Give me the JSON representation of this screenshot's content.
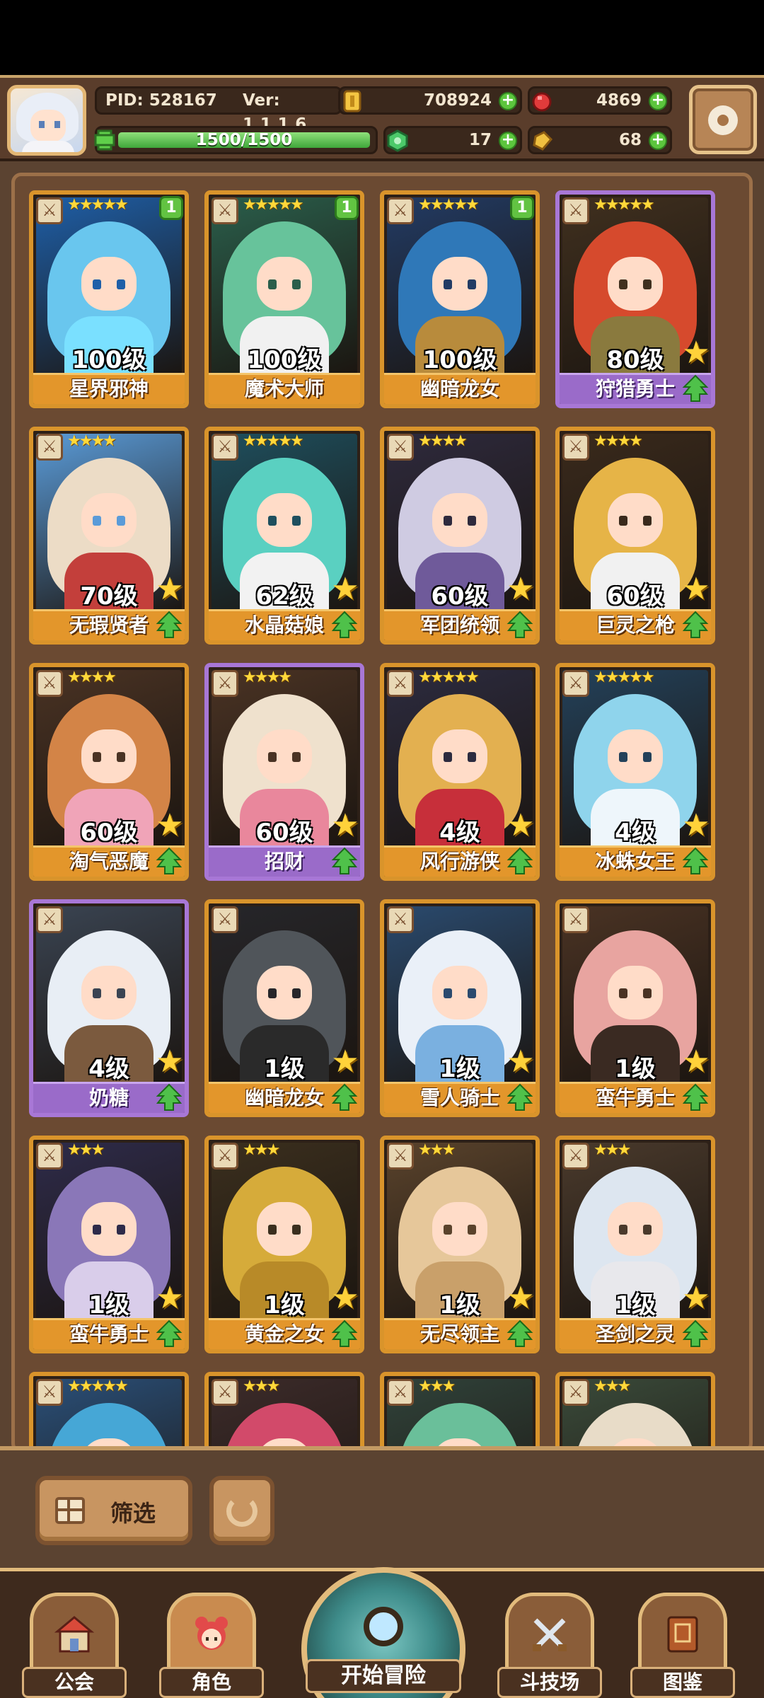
{
  "header": {
    "pid": "PID: 528167",
    "version": "Ver: 1.1.1.6",
    "stamina": "1500/1500",
    "stamina_fraction": 1.0,
    "gold": "708924",
    "ruby": "4869",
    "gem": "17",
    "bag": "68"
  },
  "characters": [
    {
      "level": "100级",
      "name": "星界邪神",
      "stars": "★★★★★",
      "badge": "1",
      "frame": "orange",
      "palette": [
        "#1e5fa8",
        "#69c6ee",
        "#7ae0ff"
      ],
      "class_icon": "weapon-icon"
    },
    {
      "level": "100级",
      "name": "魔术大师",
      "stars": "★★★★★",
      "badge": "1",
      "frame": "orange",
      "palette": [
        "#2a5e4b",
        "#67c39b",
        "#f1f1f1"
      ],
      "class_icon": "weapon-icon"
    },
    {
      "level": "100级",
      "name": "幽暗龙女",
      "stars": "★★★★★",
      "badge": "1",
      "frame": "orange",
      "palette": [
        "#223b64",
        "#2f78b8",
        "#b88b3c"
      ],
      "class_icon": "weapon-icon"
    },
    {
      "level": "80级",
      "name": "狩猎勇士",
      "stars": "★★★★★",
      "badge": "",
      "frame": "purple",
      "palette": [
        "#40301f",
        "#d64a2d",
        "#8a7a3e"
      ],
      "class_icon": "weapon-icon"
    },
    {
      "level": "70级",
      "name": "无瑕贤者",
      "stars": "★★★★",
      "badge": "",
      "frame": "orange",
      "palette": [
        "#5a9bd8",
        "#ecdcc6",
        "#c33f3b"
      ],
      "class_icon": "magic-icon"
    },
    {
      "level": "62级",
      "name": "水晶菇娘",
      "stars": "★★★★★",
      "badge": "",
      "frame": "orange",
      "palette": [
        "#1e4f5e",
        "#5ad0c1",
        "#f2f2f2"
      ],
      "class_icon": "weapon-icon"
    },
    {
      "level": "60级",
      "name": "军团统领",
      "stars": "★★★★",
      "badge": "",
      "frame": "orange",
      "palette": [
        "#2e2a3d",
        "#cfcbe2",
        "#6f5a9a"
      ],
      "class_icon": "weapon-icon"
    },
    {
      "level": "60级",
      "name": "巨灵之枪",
      "stars": "★★★★",
      "badge": "",
      "frame": "orange",
      "palette": [
        "#3a2a1c",
        "#e6b447",
        "#f1f1f1"
      ],
      "class_icon": "weapon-icon"
    },
    {
      "level": "60级",
      "name": "淘气恶魔",
      "stars": "★★★★",
      "badge": "",
      "frame": "orange",
      "palette": [
        "#4a3324",
        "#d38447",
        "#f0a4b8"
      ],
      "class_icon": "weapon-icon"
    },
    {
      "level": "60级",
      "name": "招财",
      "stars": "★★★★",
      "badge": "",
      "frame": "purple",
      "palette": [
        "#4a3324",
        "#efe1cd",
        "#e9879c"
      ],
      "class_icon": "magic-icon"
    },
    {
      "level": "4级",
      "name": "风行游侠",
      "stars": "★★★★★",
      "badge": "",
      "frame": "orange",
      "palette": [
        "#2c2b3f",
        "#e3b050",
        "#c72f3a"
      ],
      "class_icon": "bow-icon"
    },
    {
      "level": "4级",
      "name": "冰蛛女王",
      "stars": "★★★★★",
      "badge": "",
      "frame": "orange",
      "palette": [
        "#23415a",
        "#8fd4ec",
        "#eef6fb"
      ],
      "class_icon": "bow-icon"
    },
    {
      "level": "4级",
      "name": "奶糖",
      "stars": "",
      "badge": "",
      "frame": "purple",
      "palette": [
        "#3a4452",
        "#e8eef5",
        "#7b5a3e"
      ],
      "class_icon": "bow-icon"
    },
    {
      "level": "1级",
      "name": "幽暗龙女",
      "stars": "",
      "badge": "",
      "frame": "orange",
      "palette": [
        "#26262a",
        "#50555a",
        "#2a2a2a"
      ],
      "class_icon": "weapon-icon"
    },
    {
      "level": "1级",
      "name": "雪人骑士",
      "stars": "",
      "badge": "",
      "frame": "orange",
      "palette": [
        "#2a4a6e",
        "#eaf0f8",
        "#7ab0e0"
      ],
      "class_icon": "weapon-icon"
    },
    {
      "level": "1级",
      "name": "蛮牛勇士",
      "stars": "",
      "badge": "",
      "frame": "orange",
      "palette": [
        "#4a3324",
        "#e8a4a0",
        "#3a2a22"
      ],
      "class_icon": "weapon-icon"
    },
    {
      "level": "1级",
      "name": "蛮牛勇士",
      "stars": "★★★",
      "badge": "",
      "frame": "orange",
      "palette": [
        "#2e2b4a",
        "#8a77b8",
        "#d9cdea"
      ],
      "class_icon": "weapon-icon"
    },
    {
      "level": "1级",
      "name": "黄金之女",
      "stars": "★★★",
      "badge": "",
      "frame": "orange",
      "palette": [
        "#3b2f1e",
        "#d6ab3a",
        "#b88a28"
      ],
      "class_icon": "weapon-icon"
    },
    {
      "level": "1级",
      "name": "无尽领主",
      "stars": "★★★",
      "badge": "",
      "frame": "orange",
      "palette": [
        "#5a432c",
        "#e6c79a",
        "#c9a06a"
      ],
      "class_icon": "weapon-icon"
    },
    {
      "level": "1级",
      "name": "圣剑之灵",
      "stars": "★★★",
      "badge": "",
      "frame": "orange",
      "palette": [
        "#4a3a2c",
        "#dde6f0",
        "#e8e8ec"
      ],
      "class_icon": "weapon-icon"
    },
    {
      "level": "",
      "name": "",
      "stars": "★★★★★",
      "badge": "",
      "frame": "orange",
      "palette": [
        "#2a4f78",
        "#46a7d6",
        "#3f7f9f"
      ],
      "class_icon": "weapon-icon"
    },
    {
      "level": "",
      "name": "",
      "stars": "★★★",
      "badge": "",
      "frame": "orange",
      "palette": [
        "#3c2b2a",
        "#d24a6a",
        "#5aa06a"
      ],
      "class_icon": "weapon-icon"
    },
    {
      "level": "",
      "name": "",
      "stars": "★★★",
      "badge": "",
      "frame": "orange",
      "palette": [
        "#30423a",
        "#6abf9a",
        "#e8d8c6"
      ],
      "class_icon": "weapon-icon"
    },
    {
      "level": "",
      "name": "",
      "stars": "★★★",
      "badge": "",
      "frame": "orange",
      "palette": [
        "#3a4a3a",
        "#e8dcc8",
        "#6aa68a"
      ],
      "class_icon": "weapon-icon"
    }
  ],
  "panel": {
    "filter_label": "筛选"
  },
  "nav": {
    "guild": "公会",
    "characters": "角色",
    "adventure": "开始冒险",
    "arena": "斗技场",
    "codex": "图鉴"
  }
}
